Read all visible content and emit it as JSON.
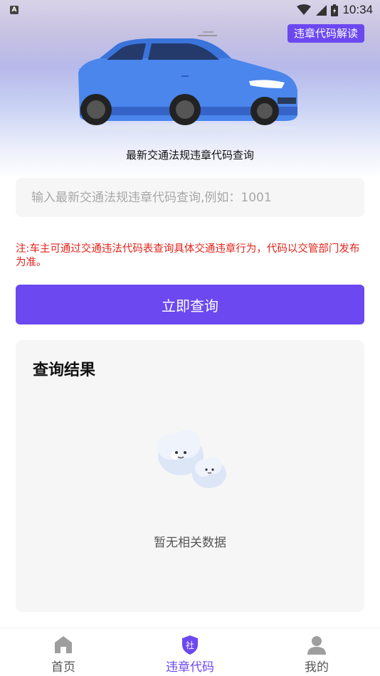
{
  "status_bar": {
    "notification_badge": "A",
    "time": "10:34"
  },
  "header": {
    "decode_button": "违章代码解读",
    "title": "最新交通法规违章代码查询"
  },
  "search": {
    "value": "",
    "placeholder": "输入最新交通法规违章代码查询,例如：1001"
  },
  "note": "注:车主可通过交通违法代码表查询具体交通违章行为，代码以交管部门发布为准。",
  "query_button": "立即查询",
  "result": {
    "title": "查询结果",
    "empty_text": "暂无相关数据"
  },
  "tabbar": {
    "items": [
      {
        "label": "首页",
        "icon": "home-icon",
        "active": false
      },
      {
        "label": "违章代码",
        "icon": "shield-badge-icon",
        "badge": "社",
        "active": true
      },
      {
        "label": "我的",
        "icon": "user-icon",
        "active": false
      }
    ]
  },
  "colors": {
    "accent": "#6b48f0",
    "warning": "#e0241c",
    "card": "#f6f6f6"
  }
}
